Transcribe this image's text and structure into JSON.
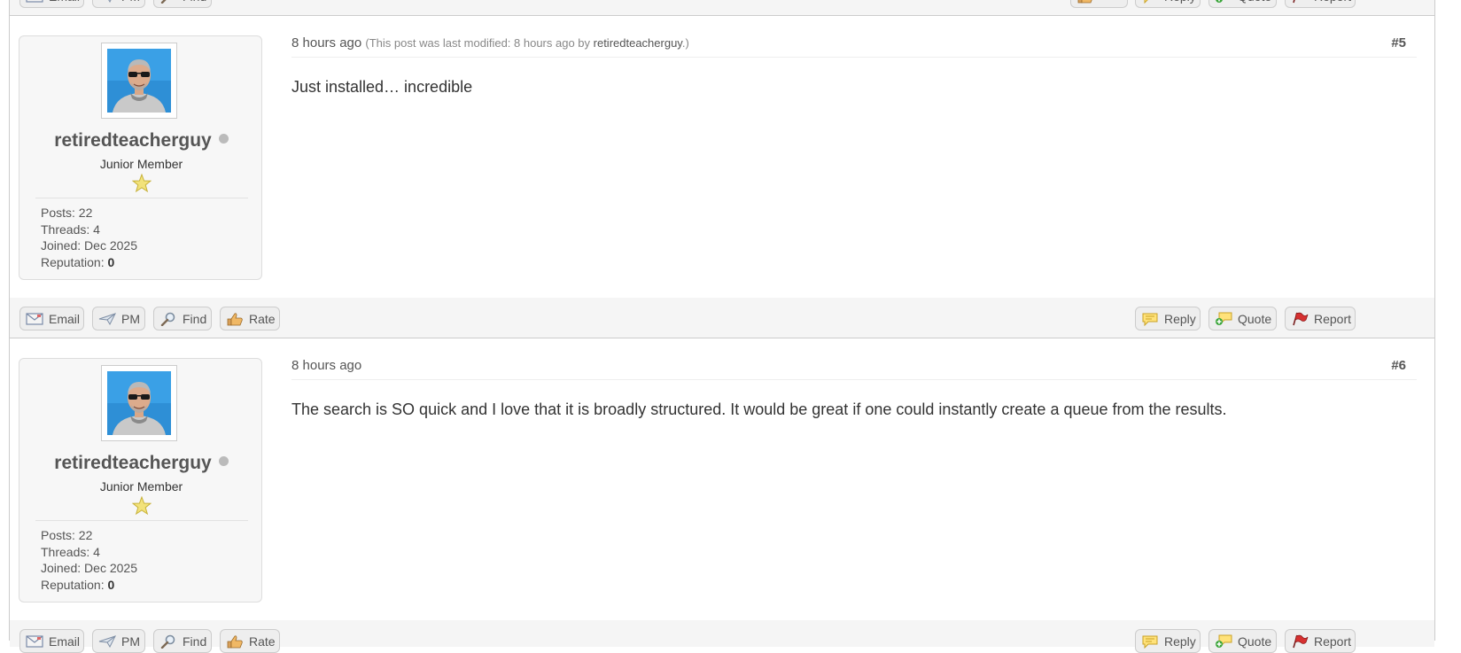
{
  "colors": {
    "bar_bg": "#f5f5f5",
    "button_bg": "#eeeeee",
    "profile_bg": "#f7f7f7",
    "offline_dot": "#bbbbbb",
    "text": "#333333"
  },
  "icons": {
    "email": "envelope-icon",
    "pm": "paper-plane-icon",
    "find": "magnifier-icon",
    "rate": "thumbs-up-icon",
    "reply": "speech-bubble-icon",
    "quote": "quote-bubble-plus-icon",
    "report": "red-flag-icon",
    "star": "star-icon",
    "status": "offline-dot-icon"
  },
  "buttons": {
    "email": "Email",
    "pm": "PM",
    "find": "Find",
    "rate": "Rate",
    "reply": "Reply",
    "quote": "Quote",
    "report": "Report"
  },
  "posts": [
    {
      "number": "#5",
      "date": "8 hours ago",
      "edit_prefix": "(This post was last modified: 8 hours ago by ",
      "edit_user": "retiredteacherguy",
      "edit_suffix": ".)",
      "body": "Just installed… incredible",
      "author": {
        "username": "retiredteacherguy",
        "title": "Junior Member",
        "stars": 1,
        "status": "offline",
        "posts_label": "Posts:",
        "posts": "22",
        "threads_label": "Threads:",
        "threads": "4",
        "joined_label": "Joined:",
        "joined": "Dec 2025",
        "reputation_label": "Reputation:",
        "reputation": "0"
      }
    },
    {
      "number": "#6",
      "date": "8 hours ago",
      "body": "The search is SO quick and I love that it is broadly structured. It would be great if one could instantly create a queue from the results.",
      "author": {
        "username": "retiredteacherguy",
        "title": "Junior Member",
        "stars": 1,
        "status": "offline",
        "posts_label": "Posts:",
        "posts": "22",
        "threads_label": "Threads:",
        "threads": "4",
        "joined_label": "Joined:",
        "joined": "Dec 2025",
        "reputation_label": "Reputation:",
        "reputation": "0"
      }
    }
  ]
}
